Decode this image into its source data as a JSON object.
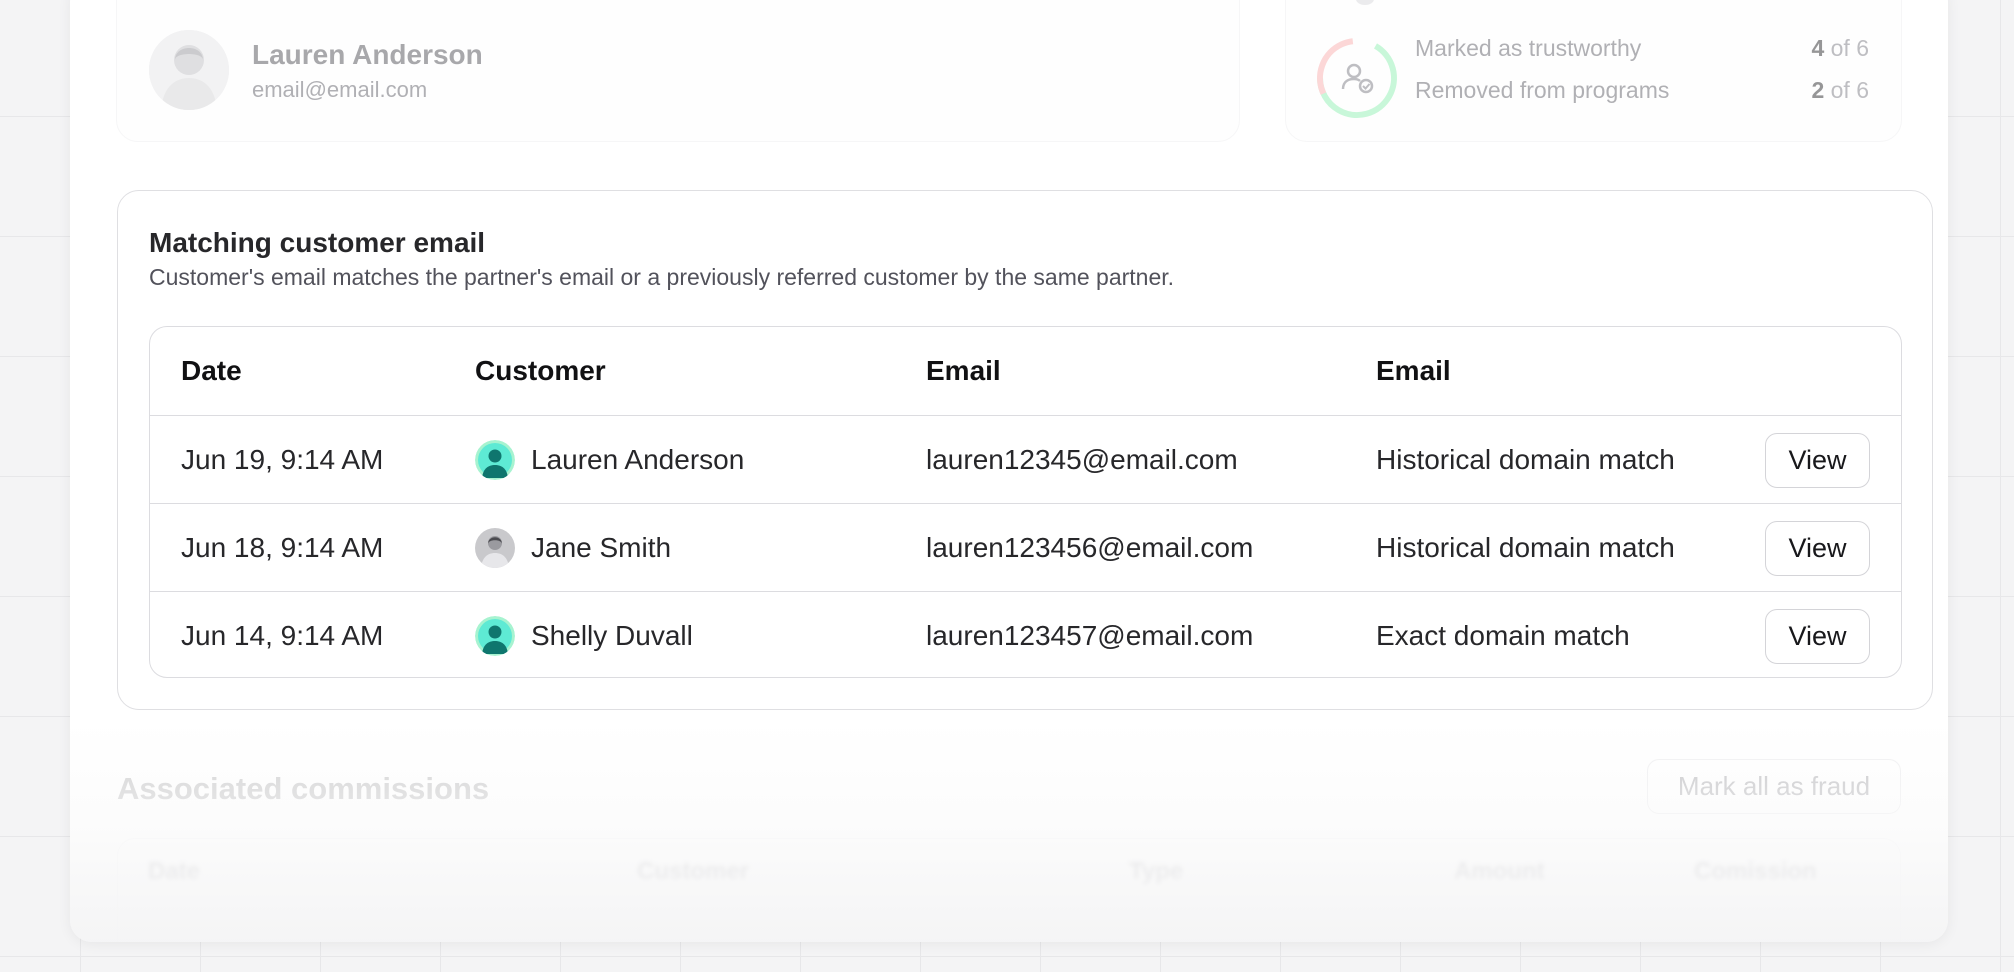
{
  "user_card": {
    "name": "Lauren Anderson",
    "email": "email@email.com"
  },
  "stats_card": {
    "items": [
      {
        "label": "Marked as trustworthy",
        "value": "4",
        "of": "of 6"
      },
      {
        "label": "Removed from programs",
        "value": "2",
        "of": "of 6"
      }
    ],
    "ring_colors": {
      "negative": "#f9a8a8",
      "positive": "#86efac"
    }
  },
  "matching": {
    "title": "Matching customer email",
    "description": "Customer's email matches the partner's email or a previously referred customer by the same partner.",
    "columns": [
      "Date",
      "Customer",
      "Email",
      "Email"
    ],
    "rows": [
      {
        "date": "Jun 19, 9:14 AM",
        "customer": "Lauren Anderson",
        "avatar": "teal-person-icon",
        "email": "lauren12345@email.com",
        "match": "Historical domain match",
        "action": "View"
      },
      {
        "date": "Jun 18, 9:14 AM",
        "customer": "Jane Smith",
        "avatar": "photo",
        "email": "lauren123456@email.com",
        "match": "Historical domain match",
        "action": "View"
      },
      {
        "date": "Jun 14, 9:14 AM",
        "customer": "Shelly Duvall",
        "avatar": "teal-person-icon",
        "email": "lauren123457@email.com",
        "match": "Exact domain match",
        "action": "View"
      }
    ]
  },
  "associated": {
    "title": "Associated commissions",
    "mark_all_label": "Mark all as fraud",
    "columns": [
      "Date",
      "Customer",
      "Type",
      "Amount",
      "Comission"
    ]
  }
}
